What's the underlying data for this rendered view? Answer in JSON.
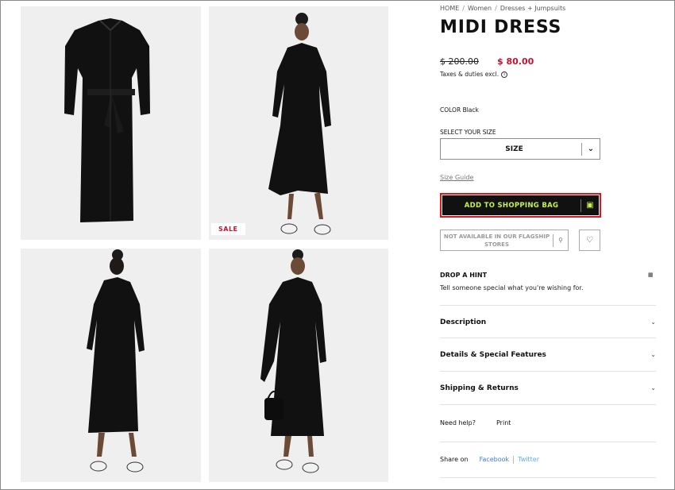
{
  "breadcrumb": [
    "HOME",
    "Women",
    "Dresses + Jumpsuits"
  ],
  "product": {
    "title": "MIDI DRESS",
    "old_price": "$ 200.00",
    "new_price": "$ 80.00",
    "taxes": "Taxes & duties excl.",
    "color_label": "COLOR",
    "color_value": "Black"
  },
  "gallery": {
    "sale_badge": "SALE"
  },
  "size": {
    "label": "SELECT YOUR SIZE",
    "select_value": "SIZE",
    "guide": "Size Guide"
  },
  "actions": {
    "add_to_bag": "ADD TO SHOPPING BAG",
    "stores": "NOT AVAILABLE IN OUR FLAGSHIP STORES"
  },
  "hint": {
    "title": "DROP A HINT",
    "text": "Tell someone special what you're wishing for."
  },
  "accordion": [
    "Description",
    "Details & Special Features",
    "Shipping & Returns"
  ],
  "help": {
    "need_help": "Need help?",
    "print": "Print"
  },
  "share": {
    "label": "Share on",
    "facebook": "Facebook",
    "twitter": "Twitter"
  },
  "colors": {
    "sale_red": "#c8102e",
    "cta_bg": "#111111",
    "cta_text": "#c6f24a",
    "highlight_border": "#e1141b"
  }
}
